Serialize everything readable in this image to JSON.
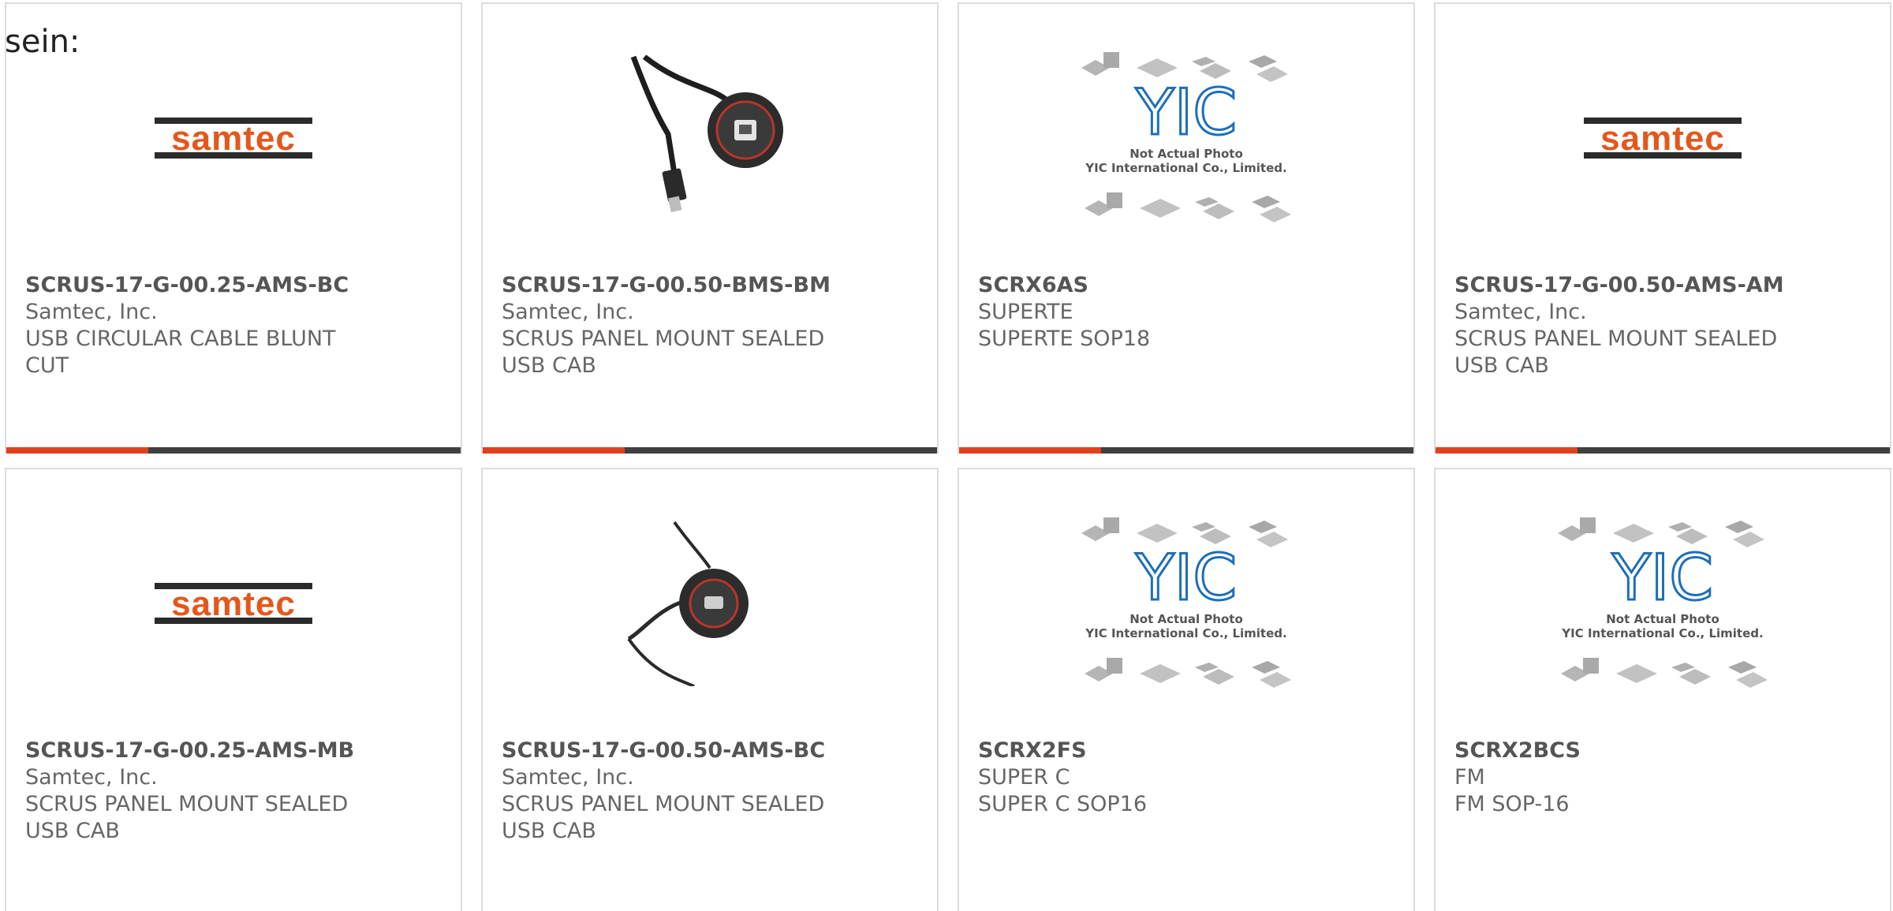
{
  "heading": "sein:",
  "colors": {
    "accent": "#e0401c",
    "bar": "#404040",
    "samtec_orange": "#e4571c",
    "samtec_dark": "#2b2b2b",
    "yic_blue": "#1d6fb8"
  },
  "placeholder": {
    "line1": "Not Actual Photo",
    "line2": "YIC International Co., Limited."
  },
  "logo": {
    "samtec": "samtec"
  },
  "products": [
    {
      "part": "SCRUS-17-G-00.25-AMS-BC",
      "maker": "Samtec, Inc.",
      "desc": "USB CIRCULAR CABLE BLUNT CUT",
      "image": "samtec-logo"
    },
    {
      "part": "SCRUS-17-G-00.50-BMS-BM",
      "maker": "Samtec, Inc.",
      "desc": "SCRUS PANEL MOUNT SEALED USB CAB",
      "image": "usb-cable-photo"
    },
    {
      "part": "SCRX6AS",
      "maker": "SUPERTE",
      "desc": "SUPERTE SOP18",
      "image": "yic-placeholder"
    },
    {
      "part": "SCRUS-17-G-00.50-AMS-AM",
      "maker": "Samtec, Inc.",
      "desc": "SCRUS PANEL MOUNT SEALED USB CAB",
      "image": "samtec-logo"
    },
    {
      "part": "SCRUS-17-G-00.25-AMS-MB",
      "maker": "Samtec, Inc.",
      "desc": "SCRUS PANEL MOUNT SEALED USB CAB",
      "image": "samtec-logo"
    },
    {
      "part": "SCRUS-17-G-00.50-AMS-BC",
      "maker": "Samtec, Inc.",
      "desc": "SCRUS PANEL MOUNT SEALED USB CAB",
      "image": "usb-panel-photo"
    },
    {
      "part": "SCRX2FS",
      "maker": "SUPER C",
      "desc": "SUPER C SOP16",
      "image": "yic-placeholder"
    },
    {
      "part": "SCRX2BCS",
      "maker": "FM",
      "desc": "FM SOP-16",
      "image": "yic-placeholder"
    }
  ]
}
